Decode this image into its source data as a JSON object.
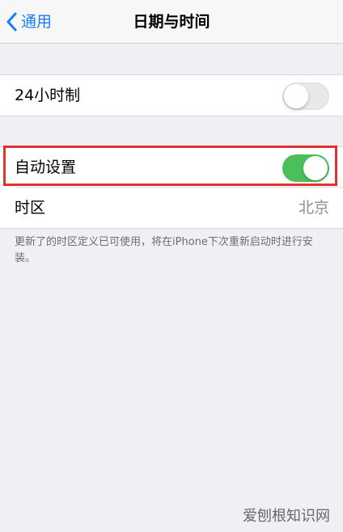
{
  "nav": {
    "back_label": "通用",
    "title": "日期与时间"
  },
  "settings": {
    "hour24": {
      "label": "24小时制",
      "enabled": false
    },
    "auto_set": {
      "label": "自动设置",
      "enabled": true
    },
    "timezone": {
      "label": "时区",
      "value": "北京"
    }
  },
  "footer_note": "更新了的时区定义已可使用，将在iPhone下次重新启动时进行安装。",
  "annotation": {
    "highlight_color": "#e3312f"
  },
  "watermark": "爱刨根知识网",
  "colors": {
    "accent": "#1a7cf5",
    "toggle_on": "#4cbf5a",
    "background": "#efeff4"
  }
}
